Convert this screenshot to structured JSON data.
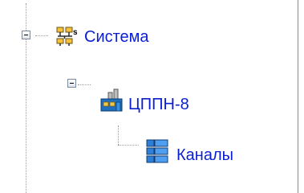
{
  "tree": {
    "root": {
      "label": "Система",
      "icon": "network-system-icon",
      "expanded": true,
      "children": [
        {
          "label": "ЦППН-8",
          "icon": "industrial-plant-icon",
          "expanded": true,
          "children": [
            {
              "label": "Каналы",
              "icon": "channels-icon"
            }
          ]
        }
      ]
    }
  },
  "colors": {
    "label_text": "#0b1fd1",
    "connector_lines": "#9a9a9a",
    "background": "#ffffff"
  }
}
